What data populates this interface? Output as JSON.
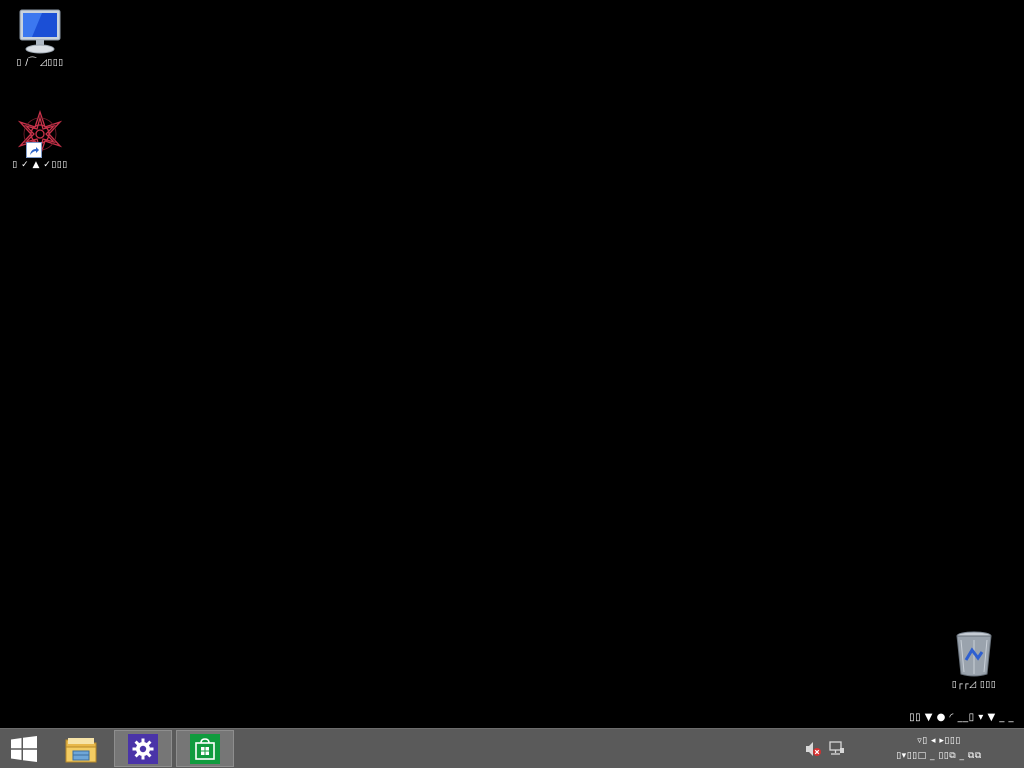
{
  "desktop": {
    "background_color": "#000000",
    "icons": [
      {
        "name": "computer",
        "label": "▯ ∕⁀ ◿▯▯▯",
        "icon": "computer-icon"
      },
      {
        "name": "app-shortcut",
        "label": "▯ ✓ ▲ ✓▯▯▯",
        "icon": "red-flower-icon"
      },
      {
        "name": "recycle-bin",
        "label": "▯┌┌◿ ▯▯▯",
        "icon": "recycle-bin-icon"
      }
    ],
    "watermark": {
      "line1": "▯▯ ▼ ● ◜ __▯ ▾ ▼ _ _"
    }
  },
  "taskbar": {
    "background_color": "#5a5a5a",
    "buttons": [
      {
        "name": "start",
        "icon": "windows-logo-icon"
      },
      {
        "name": "file-explorer",
        "icon": "folder-icon"
      },
      {
        "name": "settings",
        "icon": "gear-icon",
        "accent": "#4a34a8"
      },
      {
        "name": "store",
        "icon": "store-bag-icon",
        "accent": "#109b3e"
      }
    ],
    "tray": {
      "volume_icon": "speaker-muted-icon",
      "network_icon": "network-icon",
      "clock_time": "▿▯ ◂ ▸▯▯▯",
      "clock_date": "▯▾▯▯□ _ ▯▯⧉ _ ⧉⧉"
    }
  }
}
